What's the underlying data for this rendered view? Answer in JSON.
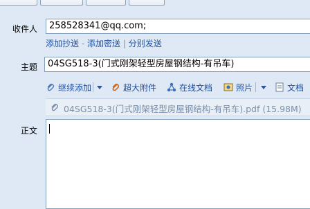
{
  "to": {
    "label": "收件人",
    "value": "258528341@qq.com;",
    "links": {
      "add_cc": "添加抄送",
      "dash": "-",
      "add_bcc": "添加密送",
      "pipe": "|",
      "separate_send": "分别发送"
    }
  },
  "subject": {
    "label": "主题",
    "value": "04SG518-3(门式刚架轻型房屋钢结构-有吊车)"
  },
  "toolbar": {
    "continue_add": "继续添加",
    "large_attachment": "超大附件",
    "online_doc": "在线文档",
    "photo": "照片",
    "document": "文档"
  },
  "attachment": {
    "name": "04SG518-3(门式刚架轻型房屋钢结构-有吊车).pdf (15.98M)"
  },
  "body": {
    "label": "正文",
    "value": ""
  },
  "colors": {
    "background": "#dfe9f6",
    "link": "#1e50a2",
    "field_border": "#7f9db9"
  }
}
